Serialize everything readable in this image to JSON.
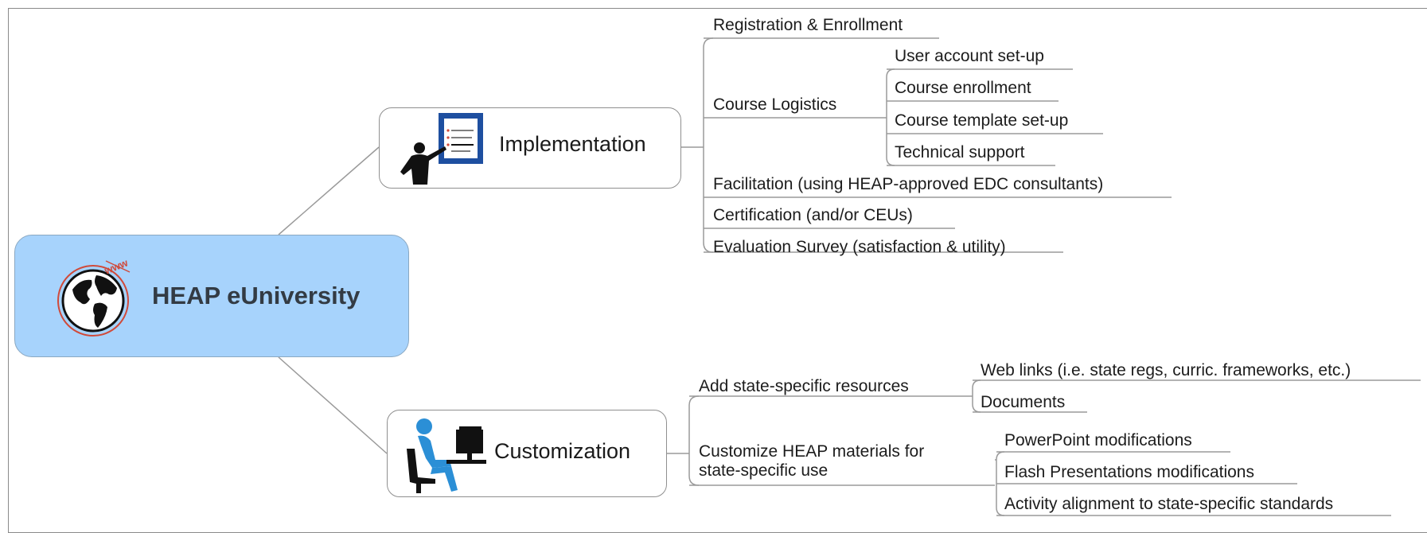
{
  "root": {
    "label": "HEAP eUniversity",
    "icon": "globe-www-icon"
  },
  "branches": [
    {
      "label": "Implementation",
      "icon": "presenter-icon",
      "children": [
        {
          "label": "Registration & Enrollment"
        },
        {
          "label": "Course Logistics",
          "children": [
            {
              "label": "User account set-up"
            },
            {
              "label": "Course enrollment"
            },
            {
              "label": "Course template set-up"
            },
            {
              "label": "Technical support"
            }
          ]
        },
        {
          "label": "Facilitation (using HEAP-approved EDC consultants)"
        },
        {
          "label": "Certification (and/or CEUs)"
        },
        {
          "label": "Evaluation Survey (satisfaction & utility)"
        }
      ]
    },
    {
      "label": "Customization",
      "icon": "computer-user-icon",
      "children": [
        {
          "label": "Add state-specific resources",
          "children": [
            {
              "label": "Web links (i.e. state regs, curric. frameworks, etc.)"
            },
            {
              "label": "Documents"
            }
          ]
        },
        {
          "label_line1": "Customize HEAP materials for",
          "label_line2": "state-specific use",
          "children": [
            {
              "label": "PowerPoint modifications"
            },
            {
              "label": "Flash Presentations modifications"
            },
            {
              "label": "Activity alignment to state-specific standards"
            }
          ]
        }
      ]
    }
  ],
  "colors": {
    "root_fill": "#a7d3fc",
    "connector": "#9a9a9a",
    "icon_blue": "#1e4fa0",
    "person_blue": "#2b8fd6"
  }
}
